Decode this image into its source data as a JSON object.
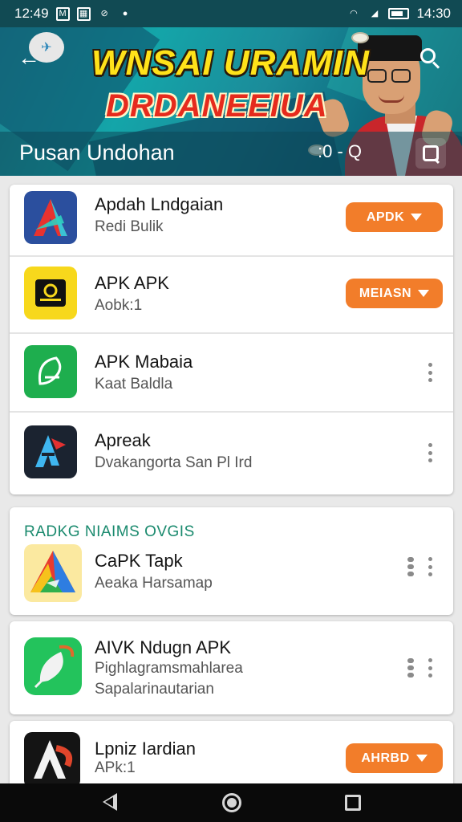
{
  "status_bar": {
    "time_left": "12:49",
    "time_right": "14:30",
    "icons_left": [
      "notification-m-icon",
      "notification-grid-icon",
      "notification-slash-icon",
      "notification-dot-icon"
    ],
    "icons_right": [
      "wifi-icon",
      "signal-icon",
      "battery-icon"
    ]
  },
  "header": {
    "banner_line1": "WNSAI URAMIN",
    "banner_line2": "DRDANEEIUA",
    "title": "Pusan Undohan",
    "count": ":0 - Q",
    "colors": {
      "accent": "#14a5a9",
      "dark": "#0c4f63"
    }
  },
  "apps_top": [
    {
      "name": "Apdah Lndgaian",
      "subtitle": "Redi Bulik",
      "action": "APDK",
      "icon": "apk-arrow-icon"
    },
    {
      "name": "APK APK",
      "subtitle": "Aobk:1",
      "action": "MEIASN",
      "icon": "apk-box-icon"
    },
    {
      "name": "APK Mabaia",
      "subtitle": "Kaat Baldla",
      "icon": "apk-green-icon"
    },
    {
      "name": "Apreak",
      "subtitle": "Dvakangorta San Pl Ird",
      "icon": "apk-blue-flag-icon"
    }
  ],
  "section": {
    "title": "RADKG NIAIMS OVGIS"
  },
  "apps_section": [
    {
      "name": "CaPK Tapk",
      "subtitle": "Aeaka Harsamap",
      "icon": "apk-triangle-icon"
    }
  ],
  "apps_single": [
    {
      "name": "AIVK Ndugn APK",
      "subtitle": "Pighlagramsmahlarea",
      "subtitle2": "Sapalarinautarian",
      "icon": "apk-feather-icon"
    }
  ],
  "apps_bottom": [
    {
      "name": "Lpniz Iardian",
      "subtitle": "APk:1",
      "action": "AHRBD",
      "icon": "apk-dark-a-icon"
    }
  ],
  "action_color": "#f27d2a"
}
